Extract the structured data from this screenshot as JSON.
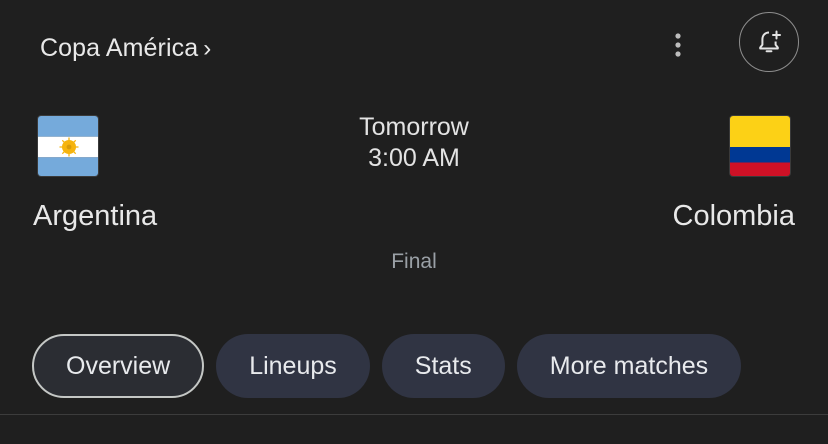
{
  "header": {
    "competition": "Copa América",
    "competition_chevron": "›",
    "more_icon": "more-vert-icon",
    "follow_icon": "notification-add-icon"
  },
  "match": {
    "home_team": {
      "name": "Argentina",
      "flag_icon": "argentina-flag-icon"
    },
    "away_team": {
      "name": "Colombia",
      "flag_icon": "colombia-flag-icon"
    },
    "day": "Tomorrow",
    "time": "3:00 AM",
    "stage": "Final"
  },
  "tabs": [
    {
      "label": "Overview",
      "selected": true
    },
    {
      "label": "Lineups",
      "selected": false
    },
    {
      "label": "Stats",
      "selected": false
    },
    {
      "label": "More matches",
      "selected": false
    }
  ],
  "colors": {
    "background": "#1f1f1f",
    "chip": "#303443",
    "chip_selected_border": "#c4c7c5",
    "argentina_blue": "#75aadb",
    "colombia_yellow": "#fcd116",
    "colombia_blue": "#003893",
    "colombia_red": "#ce1126"
  }
}
